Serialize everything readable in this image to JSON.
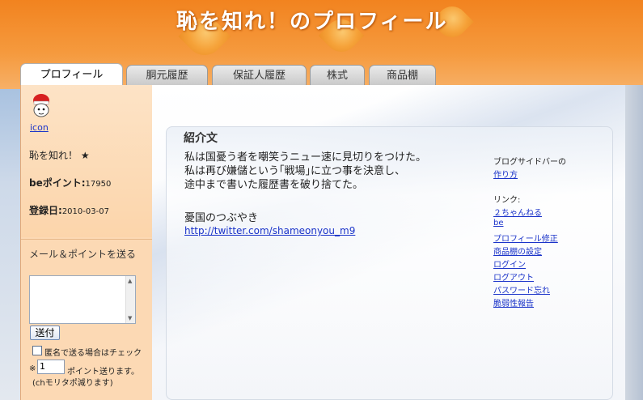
{
  "header": {
    "title": "恥を知れ！のプロフィール"
  },
  "tabs": [
    {
      "label": "プロフィール",
      "active": true
    },
    {
      "label": "胴元履歴",
      "active": false
    },
    {
      "label": "保証人履歴",
      "active": false
    },
    {
      "label": "株式",
      "active": false
    },
    {
      "label": "商品棚",
      "active": false
    }
  ],
  "sidebar": {
    "icon_link": "icon",
    "name": "恥を知れ！ ★",
    "be_points_label": "beポイント:",
    "be_points_value": "17950",
    "registered_label": "登録日:",
    "registered_value": "2010-03-07",
    "mail_title": "メール＆ポイントを送る",
    "send_button": "送付",
    "anon_label": "匿名で送る場合はチェック",
    "points_prefix": "※",
    "points_value": "1",
    "points_label": "ポイント送ります。",
    "points_note": "(chモリタポ減ります)"
  },
  "main": {
    "section_title": "紹介文",
    "intro_lines": [
      "私は国憂う者を嘲笑うニュー速に見切りをつけた。",
      "私は再び嫌儲という｢戦場｣に立つ事を決意し、",
      "途中まで書いた履歴書を破り捨てた。"
    ],
    "sub_title": "憂国のつぶやき",
    "twitter_link": "http://twitter.com/shameonyou_m9"
  },
  "side_links": {
    "blog_label": "ブログサイドバーの",
    "blog_link": "作り方",
    "links_label": "リンク:",
    "links": [
      "２ちゃんねる",
      "be",
      "プロフィール修正",
      "商品棚の設定",
      "ログイン",
      "ログアウト",
      "パスワード忘れ",
      "脆弱性報告"
    ]
  },
  "colors": {
    "header_orange": "#f2831f",
    "sidebar_peach": "#fcd9b4",
    "link_blue": "#1a33c9"
  }
}
